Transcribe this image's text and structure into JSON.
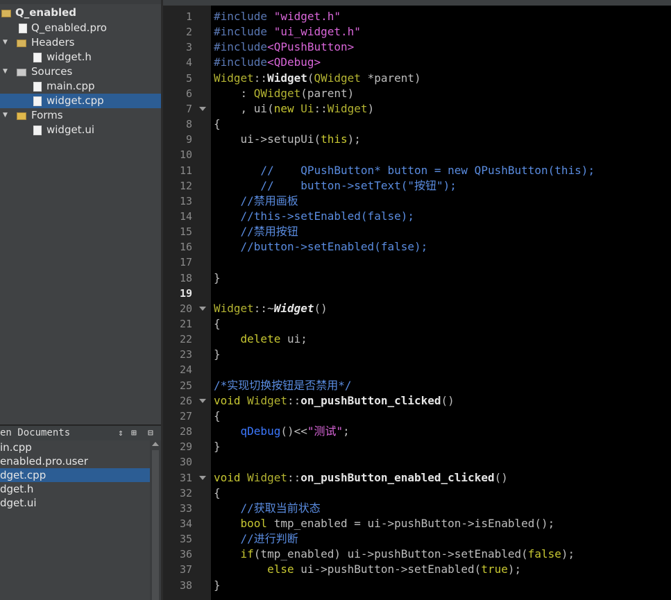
{
  "tree": {
    "project": "Q_enabled",
    "items": [
      {
        "label": "Q_enabled.pro"
      },
      {
        "label": "Headers"
      },
      {
        "label": "widget.h"
      },
      {
        "label": "Sources"
      },
      {
        "label": "main.cpp"
      },
      {
        "label": "widget.cpp"
      },
      {
        "label": "Forms"
      },
      {
        "label": "widget.ui"
      }
    ]
  },
  "open_documents": {
    "title": "en Documents",
    "items": [
      {
        "label": "in.cpp"
      },
      {
        "label": "enabled.pro.user"
      },
      {
        "label": "dget.cpp"
      },
      {
        "label": "dget.h"
      },
      {
        "label": "dget.ui"
      }
    ]
  },
  "editor": {
    "current_line": "19",
    "lines": [
      {
        "n": "1"
      },
      {
        "n": "2"
      },
      {
        "n": "3"
      },
      {
        "n": "4"
      },
      {
        "n": "5"
      },
      {
        "n": "6"
      },
      {
        "n": "7"
      },
      {
        "n": "8"
      },
      {
        "n": "9"
      },
      {
        "n": "10"
      },
      {
        "n": "11"
      },
      {
        "n": "12"
      },
      {
        "n": "13"
      },
      {
        "n": "14"
      },
      {
        "n": "15"
      },
      {
        "n": "16"
      },
      {
        "n": "17"
      },
      {
        "n": "18"
      },
      {
        "n": "19"
      },
      {
        "n": "20"
      },
      {
        "n": "21"
      },
      {
        "n": "22"
      },
      {
        "n": "23"
      },
      {
        "n": "24"
      },
      {
        "n": "25"
      },
      {
        "n": "26"
      },
      {
        "n": "27"
      },
      {
        "n": "28"
      },
      {
        "n": "29"
      },
      {
        "n": "30"
      },
      {
        "n": "31"
      },
      {
        "n": "32"
      },
      {
        "n": "33"
      },
      {
        "n": "34"
      },
      {
        "n": "35"
      },
      {
        "n": "36"
      },
      {
        "n": "37"
      },
      {
        "n": "38"
      }
    ],
    "code": [
      [
        [
          "pp",
          "#include "
        ],
        [
          "str",
          "\"widget.h\""
        ]
      ],
      [
        [
          "pp",
          "#include "
        ],
        [
          "str",
          "\"ui_widget.h\""
        ]
      ],
      [
        [
          "pp",
          "#include"
        ],
        [
          "str",
          "<QPushButton>"
        ]
      ],
      [
        [
          "pp",
          "#include"
        ],
        [
          "str",
          "<QDebug>"
        ]
      ],
      [
        [
          "ty",
          "Widget"
        ],
        [
          "op",
          "::"
        ],
        [
          "fn",
          "Widget"
        ],
        [
          "op",
          "("
        ],
        [
          "ty",
          "QWidget"
        ],
        [
          "pl",
          " *parent)"
        ]
      ],
      [
        [
          "pl",
          "    : "
        ],
        [
          "ty",
          "QWidget"
        ],
        [
          "pl",
          "(parent)"
        ]
      ],
      [
        [
          "pl",
          "    , ui("
        ],
        [
          "kw",
          "new "
        ],
        [
          "ty",
          "Ui"
        ],
        [
          "op",
          "::"
        ],
        [
          "ty",
          "Widget"
        ],
        [
          "pl",
          ")"
        ]
      ],
      [
        [
          "pl",
          "{"
        ]
      ],
      [
        [
          "pl",
          "    ui->setupUi("
        ],
        [
          "kw",
          "this"
        ],
        [
          "pl",
          ");"
        ]
      ],
      [
        [
          "pl",
          ""
        ]
      ],
      [
        [
          "cm",
          "       //    QPushButton* button = new QPushButton(this);"
        ]
      ],
      [
        [
          "cm",
          "       //    button->setText(\"按钮\");"
        ]
      ],
      [
        [
          "cm",
          "    //禁用画板"
        ]
      ],
      [
        [
          "cm",
          "    //this->setEnabled(false);"
        ]
      ],
      [
        [
          "cm",
          "    //禁用按钮"
        ]
      ],
      [
        [
          "cm",
          "    //button->setEnabled(false);"
        ]
      ],
      [
        [
          "pl",
          ""
        ]
      ],
      [
        [
          "pl",
          "}"
        ]
      ],
      [
        [
          "pl",
          ""
        ]
      ],
      [
        [
          "ty",
          "Widget"
        ],
        [
          "op",
          "::~"
        ],
        [
          "fn it",
          "Widget"
        ],
        [
          "pl",
          "()"
        ]
      ],
      [
        [
          "pl",
          "{"
        ]
      ],
      [
        [
          "pl",
          "    "
        ],
        [
          "kw",
          "delete"
        ],
        [
          "pl",
          " ui;"
        ]
      ],
      [
        [
          "pl",
          "}"
        ]
      ],
      [
        [
          "pl",
          ""
        ]
      ],
      [
        [
          "cm",
          "/*实现切换按钮是否禁用*/"
        ]
      ],
      [
        [
          "kw",
          "void "
        ],
        [
          "ty",
          "Widget"
        ],
        [
          "op",
          "::"
        ],
        [
          "fn",
          "on_pushButton_clicked"
        ],
        [
          "pl",
          "()"
        ]
      ],
      [
        [
          "pl",
          "{"
        ]
      ],
      [
        [
          "pl",
          "    "
        ],
        [
          "qd",
          "qDebug"
        ],
        [
          "pl",
          "()<<"
        ],
        [
          "str",
          "\"测试\""
        ],
        [
          "pl",
          ";"
        ]
      ],
      [
        [
          "pl",
          "}"
        ]
      ],
      [
        [
          "pl",
          ""
        ]
      ],
      [
        [
          "kw",
          "void "
        ],
        [
          "ty",
          "Widget"
        ],
        [
          "op",
          "::"
        ],
        [
          "fn",
          "on_pushButton_enabled_clicked"
        ],
        [
          "pl",
          "()"
        ]
      ],
      [
        [
          "pl",
          "{"
        ]
      ],
      [
        [
          "cm",
          "    //获取当前状态"
        ]
      ],
      [
        [
          "pl",
          "    "
        ],
        [
          "kw",
          "bool"
        ],
        [
          "pl",
          " tmp_enabled = ui->pushButton->isEnabled();"
        ]
      ],
      [
        [
          "cm",
          "    //进行判断"
        ]
      ],
      [
        [
          "pl",
          "    "
        ],
        [
          "kw",
          "if"
        ],
        [
          "pl",
          "(tmp_enabled) ui->pushButton->setEnabled("
        ],
        [
          "kw",
          "false"
        ],
        [
          "pl",
          ");"
        ]
      ],
      [
        [
          "pl",
          "        "
        ],
        [
          "kw",
          "else"
        ],
        [
          "pl",
          " ui->pushButton->setEnabled("
        ],
        [
          "kw",
          "true"
        ],
        [
          "pl",
          ");"
        ]
      ],
      [
        [
          "pl",
          "}"
        ]
      ]
    ]
  }
}
